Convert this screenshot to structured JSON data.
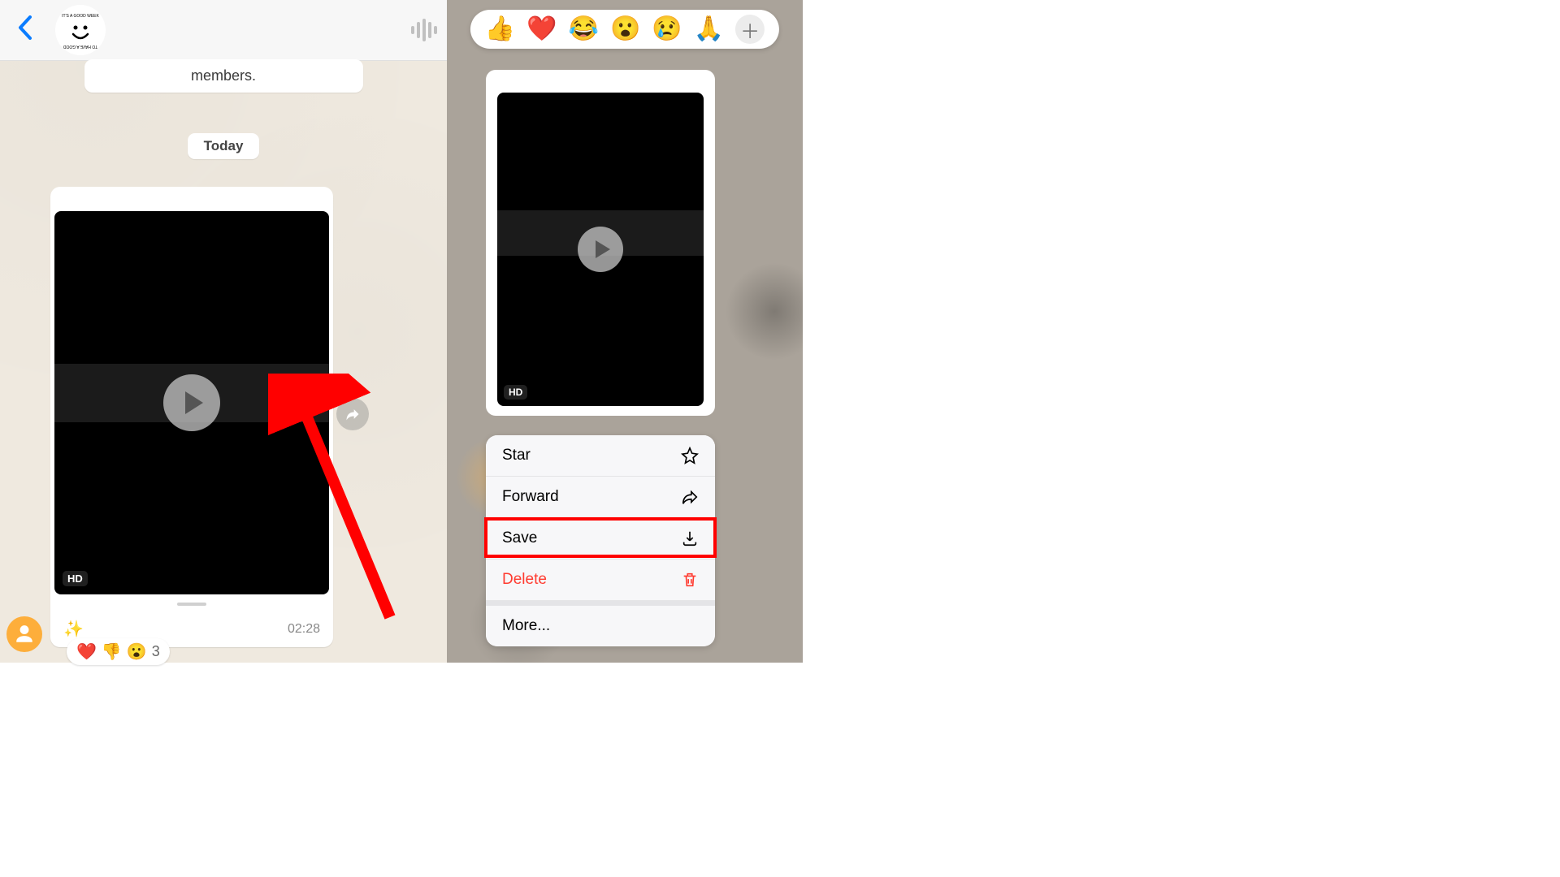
{
  "left": {
    "system_message": "members.",
    "date_label": "Today",
    "hd_badge": "HD",
    "timestamp": "02:28",
    "sparkle_emoji": "✨",
    "reactions": {
      "emojis": [
        "❤️",
        "👎",
        "😮"
      ],
      "count": "3"
    }
  },
  "right": {
    "reaction_emojis": [
      "👍",
      "❤️",
      "😂",
      "😮",
      "😢",
      "🙏"
    ],
    "plus": "＋",
    "hd_badge": "HD",
    "menu": {
      "star": "Star",
      "forward": "Forward",
      "save": "Save",
      "delete": "Delete",
      "more": "More..."
    }
  }
}
